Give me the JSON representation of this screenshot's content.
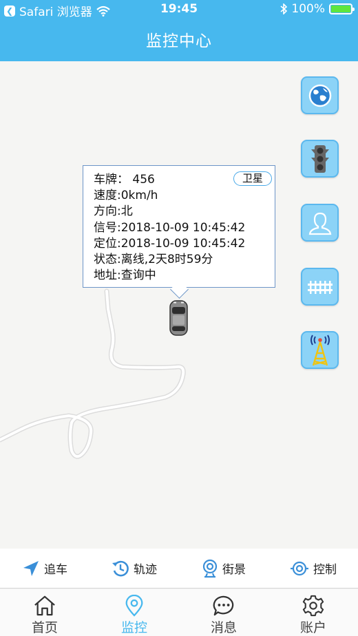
{
  "status_bar": {
    "back_label": "Safari 浏览器",
    "time": "19:45",
    "battery": "100%",
    "battery_level": 1.0
  },
  "header": {
    "title": "监控中心"
  },
  "info_window": {
    "sat_button": "卫星",
    "plate": "车牌： 456",
    "speed": "速度:0km/h",
    "direction": "方向:北",
    "signal": "信号:2018-10-09 10:45:42",
    "location": "定位:2018-10-09 10:45:42",
    "state": "状态:离线,2天8时59分",
    "address": "地址:查询中"
  },
  "map_buttons": [
    {
      "icon": "globe-icon"
    },
    {
      "icon": "traffic-light-icon"
    },
    {
      "icon": "person-icon"
    },
    {
      "icon": "railway-icon"
    },
    {
      "icon": "signal-tower-icon"
    }
  ],
  "actions": [
    {
      "label": "追车",
      "icon": "navigation-arrow-icon"
    },
    {
      "label": "轨迹",
      "icon": "history-icon"
    },
    {
      "label": "街景",
      "icon": "camera-icon"
    },
    {
      "label": "控制",
      "icon": "target-icon"
    }
  ],
  "tabs": [
    {
      "label": "首页",
      "icon": "home-icon",
      "active": false
    },
    {
      "label": "监控",
      "icon": "location-pin-icon",
      "active": true
    },
    {
      "label": "消息",
      "icon": "message-icon",
      "active": false
    },
    {
      "label": "账户",
      "icon": "gear-icon",
      "active": false
    }
  ],
  "colors": {
    "accent": "#47b8ee",
    "map_button": "#8cd3f7",
    "battery_fill": "#5ee63e"
  }
}
